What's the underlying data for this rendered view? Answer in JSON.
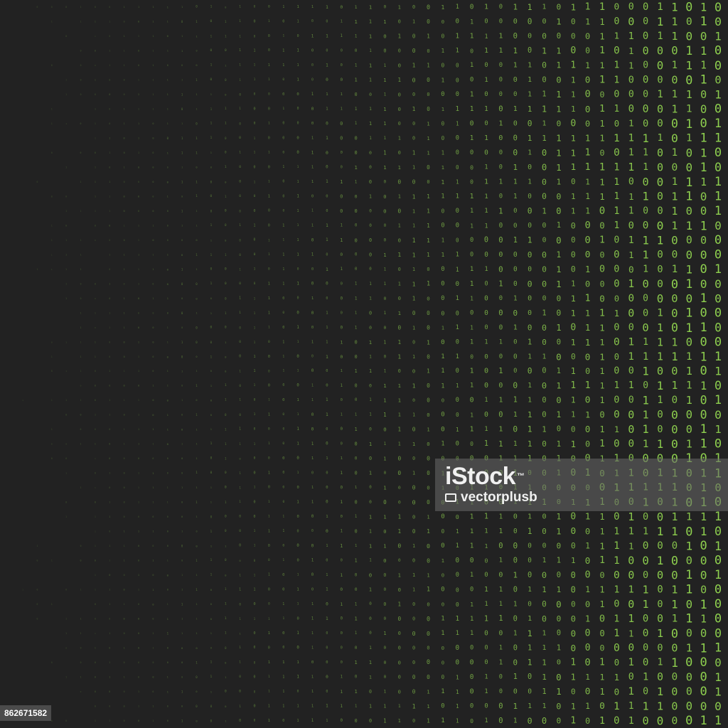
{
  "image": {
    "background_color": "#222222",
    "digit_color": "#8fd14f",
    "digits": [
      "0",
      "1"
    ],
    "columns": 49,
    "rows": 50,
    "fade": "left-to-right"
  },
  "watermark": {
    "logo_text": "iStock",
    "logo_mark": "™",
    "credit_text": "vectorplusb",
    "camera_icon": "camera-icon"
  },
  "stock_id": "862671582"
}
